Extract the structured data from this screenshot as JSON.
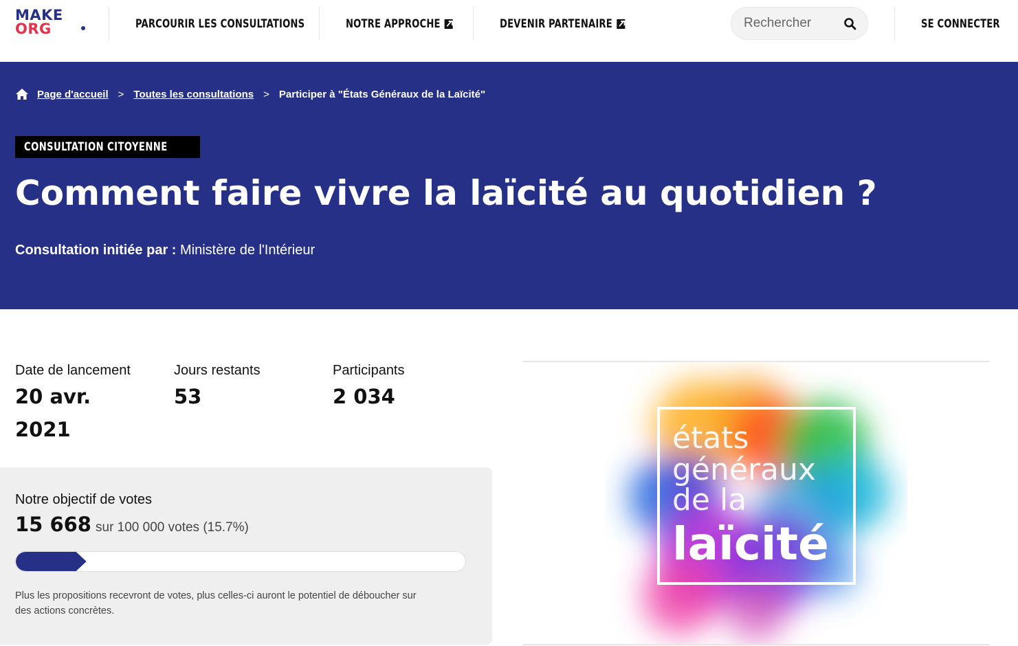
{
  "brand": {
    "logo_line1": "MAKE",
    "logo_line2": "ORG",
    "primary": "#253086",
    "accent": "#e5334b"
  },
  "nav": {
    "items": [
      {
        "label": "PARCOURIR LES CONSULTATIONS",
        "external": false
      },
      {
        "label": "NOTRE APPROCHE",
        "external": true
      },
      {
        "label": "DEVENIR PARTENAIRE",
        "external": true
      }
    ],
    "search_placeholder": "Rechercher",
    "login_label": "SE CONNECTER"
  },
  "breadcrumb": {
    "home": "Page d'accueil",
    "all": "Toutes les consultations",
    "current": "Participer à \"États Généraux de la Laïcité\"",
    "separator": ">"
  },
  "hero": {
    "badge": "CONSULTATION CITOYENNE",
    "title": "Comment faire vivre la laïcité au quotidien ?",
    "initiator_label": "Consultation initiée par :",
    "initiator_value": "Ministère de l'Intérieur"
  },
  "stats": [
    {
      "label": "Date de lancement",
      "value_line1": "20 avr.",
      "value_line2": "2021"
    },
    {
      "label": "Jours restants",
      "value_line1": "53",
      "value_line2": ""
    },
    {
      "label": "Participants",
      "value_line1": "2 034",
      "value_line2": ""
    }
  ],
  "votes": {
    "title": "Notre objectif de votes",
    "count": "15 668",
    "goal_text": "sur 100 000 votes (15.7%)",
    "progress_fraction": 0.157,
    "note": "Plus les propositions recevront de votes, plus celles-ci auront le potentiel de déboucher sur des actions concrètes."
  },
  "visual": {
    "line1": "états",
    "line2": "généraux",
    "line3": "de la",
    "line4": "laïcité"
  }
}
